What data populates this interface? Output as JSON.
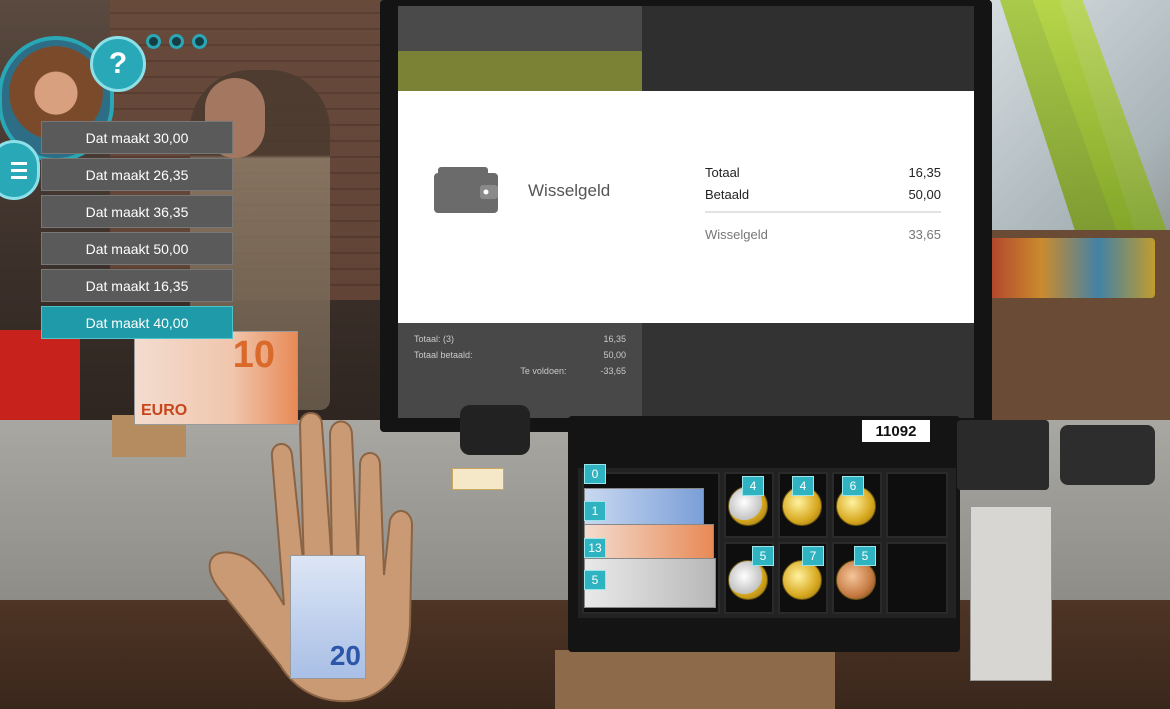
{
  "avatar": {
    "help_label": "?"
  },
  "options": [
    {
      "label": "Dat maakt 30,00",
      "selected": false
    },
    {
      "label": "Dat maakt 26,35",
      "selected": false
    },
    {
      "label": "Dat maakt 36,35",
      "selected": false
    },
    {
      "label": "Dat maakt 50,00",
      "selected": false
    },
    {
      "label": "Dat maakt 16,35",
      "selected": false
    },
    {
      "label": "Dat maakt 40,00",
      "selected": true
    }
  ],
  "register_screen": {
    "popup_title": "Wisselgeld",
    "summary": {
      "total_label": "Totaal",
      "total_value": "16,35",
      "paid_label": "Betaald",
      "paid_value": "50,00",
      "change_label": "Wisselgeld",
      "change_value": "33,65"
    },
    "bottom": {
      "total_label": "Totaal: (3)",
      "total_value": "16,35",
      "paid_label": "Totaal betaald:",
      "paid_value": "50,00",
      "due_label": "Te voldoen:",
      "due_value": "-33,65"
    }
  },
  "drawer": {
    "serial": "11092",
    "badges": {
      "slot_0": "0",
      "bill_20": "1",
      "bill_10": "13",
      "bill_5": "5",
      "coin_2": "4",
      "coin_050": "4",
      "coin_010": "6",
      "coin_1": "5",
      "coin_020": "7",
      "coin_005": "5"
    }
  },
  "held_bill": {
    "denomination": "20"
  },
  "counter_bill": {
    "denomination": "10",
    "text": "EURO"
  },
  "colors": {
    "accent": "#29a9b8",
    "selected_option": "#1e9aa8",
    "option_bg": "#5a5a5a"
  }
}
